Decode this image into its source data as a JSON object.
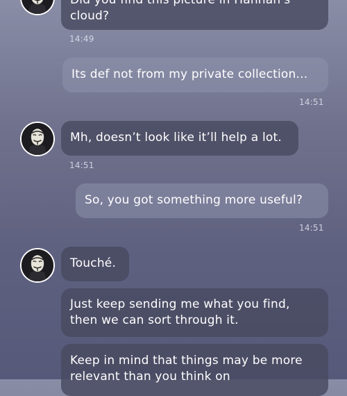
{
  "messages": [
    {
      "side": "in",
      "text": "Did you find this picture in Hannah's cloud?",
      "time": "14:49",
      "avatar": "mask-avatar"
    },
    {
      "side": "out",
      "text": "Its def not from my private collection...",
      "time": "14:51"
    },
    {
      "side": "in",
      "text": "Mh, doesn’t look like it’ll help a lot.",
      "time": "14:51",
      "avatar": "mask-avatar"
    },
    {
      "side": "out",
      "text": "So, you got something more useful?",
      "time": "14:51"
    },
    {
      "side": "in",
      "text": "Touché.",
      "avatar": "mask-avatar"
    },
    {
      "side": "in",
      "text": "Just keep sending me what you find, then we can sort through it."
    },
    {
      "side": "in",
      "text": "Keep in mind that things may be more relevant than you think on"
    }
  ]
}
